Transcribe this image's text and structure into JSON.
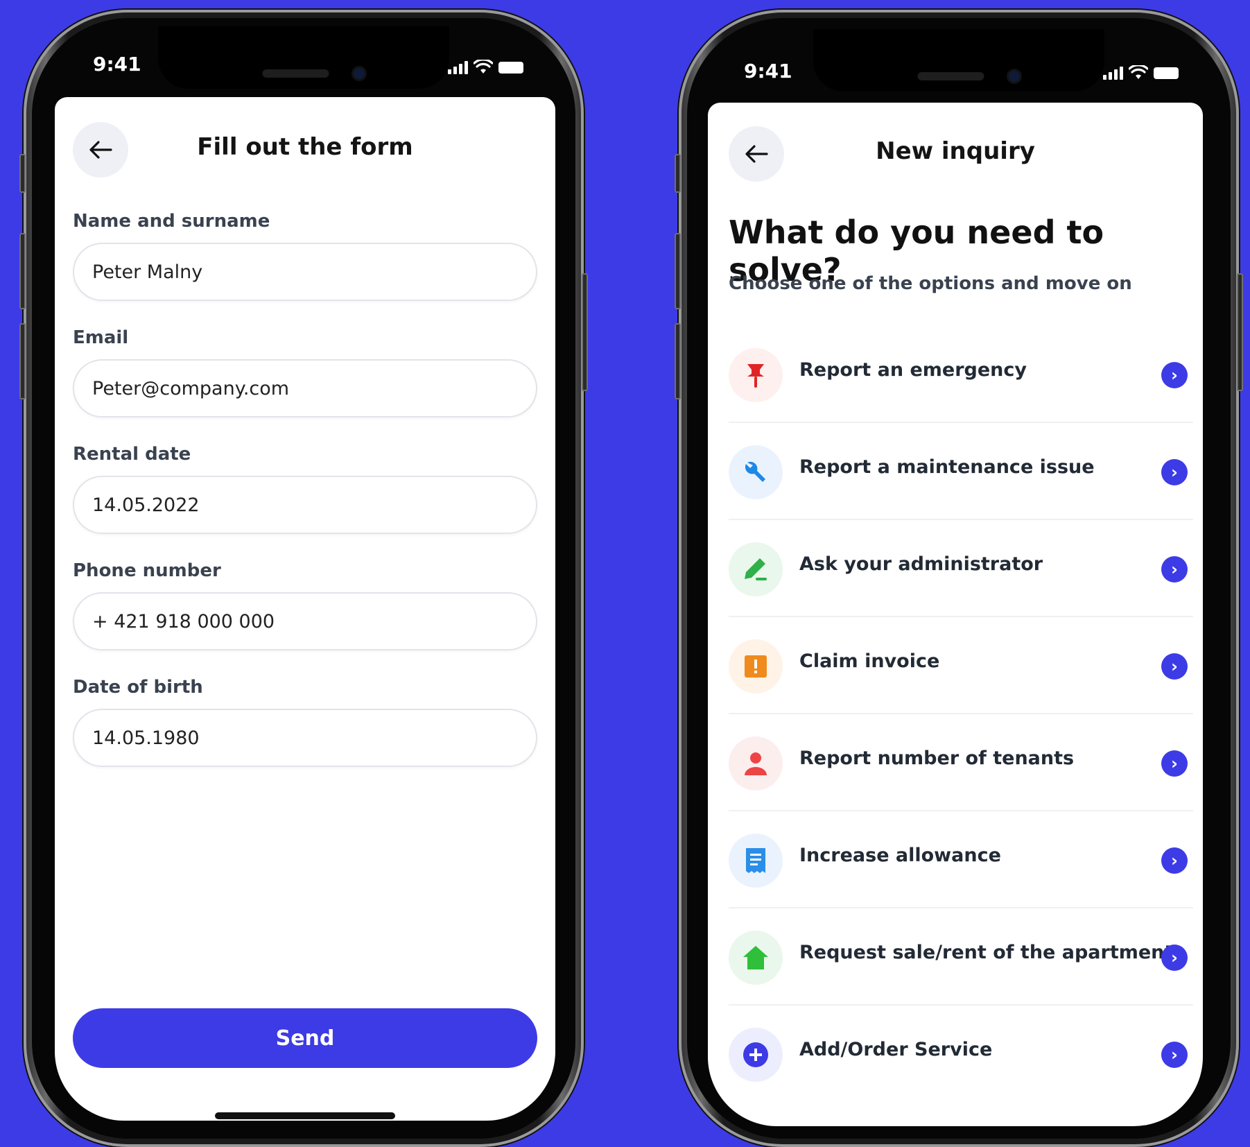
{
  "colors": {
    "background": "#3d3be6",
    "accent": "#3d3be6"
  },
  "left_phone": {
    "status_time": "9:41",
    "nav": {
      "back_icon": "arrow-left-icon",
      "title": "Fill out the form"
    },
    "fields": [
      {
        "label": "Name and surname",
        "value": "Peter Malny"
      },
      {
        "label": "Email",
        "value": "Peter@company.com"
      },
      {
        "label": "Rental date",
        "value": "14.05.2022"
      },
      {
        "label": "Phone number",
        "value": "+ 421 918 000 000"
      },
      {
        "label": "Date of birth",
        "value": "14.05.1980"
      }
    ],
    "send_label": "Send"
  },
  "right_phone": {
    "status_time": "9:41",
    "nav": {
      "back_icon": "arrow-left-icon",
      "title": "New inquiry"
    },
    "headline": "What do you need to solve?",
    "subline": "Choose one of the options and move on",
    "options": [
      {
        "label": "Report an emergency",
        "icon": "pushpin-icon",
        "color": "#e02424",
        "bg": "#fdf0ee"
      },
      {
        "label": "Report a maintenance issue",
        "icon": "wrench-icon",
        "color": "#1e88e5",
        "bg": "#eaf3fd"
      },
      {
        "label": "Ask your administrator",
        "icon": "pencil-icon",
        "color": "#2fb04a",
        "bg": "#eaf7ec"
      },
      {
        "label": "Claim invoice",
        "icon": "warning-icon",
        "color": "#f08a1c",
        "bg": "#fef3e6"
      },
      {
        "label": "Report number of tenants",
        "icon": "person-icon",
        "color": "#ee4444",
        "bg": "#fdeeee"
      },
      {
        "label": "Increase allowance",
        "icon": "receipt-icon",
        "color": "#2b8ee8",
        "bg": "#eaf3fd"
      },
      {
        "label": "Request sale/rent of the apartment",
        "icon": "house-icon",
        "color": "#2fbf3a",
        "bg": "#eaf7ec"
      },
      {
        "label": "Add/Order Service",
        "icon": "plus-circle-icon",
        "color": "#3d3be6",
        "bg": "#eceefd"
      }
    ]
  }
}
